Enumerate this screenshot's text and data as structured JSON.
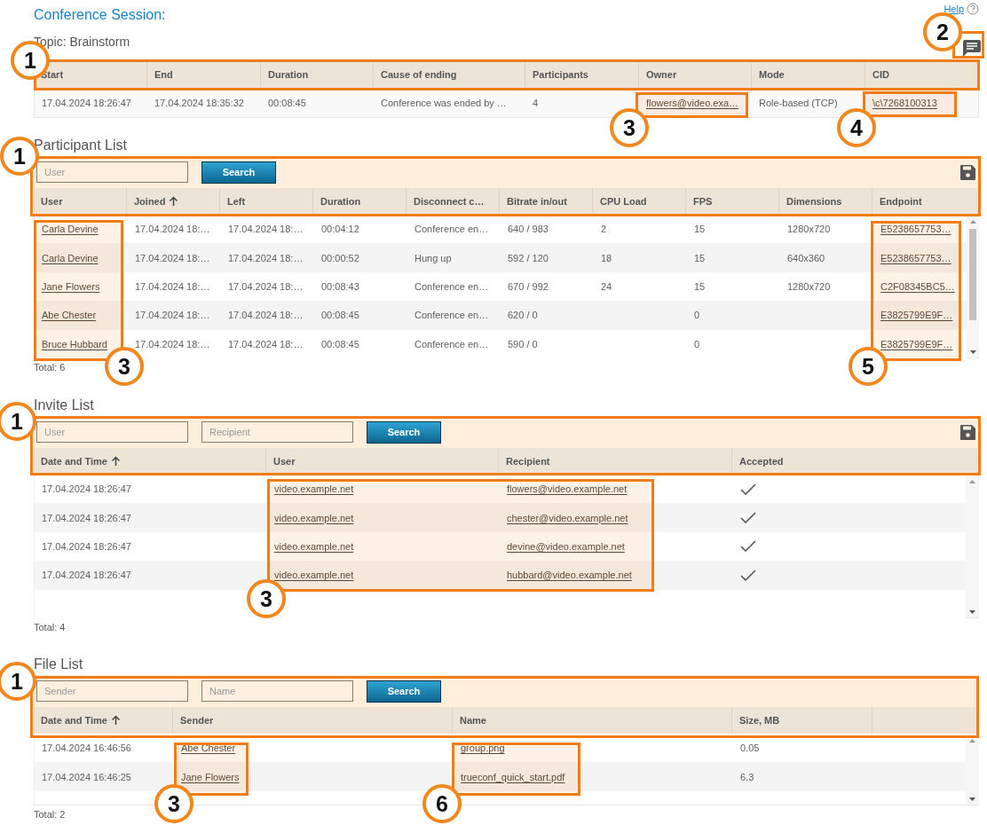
{
  "page": {
    "title": "Conference Session:",
    "help": "Help",
    "topic": "Topic: Brainstorm"
  },
  "session": {
    "columns": [
      {
        "label": "Start"
      },
      {
        "label": "End"
      },
      {
        "label": "Duration"
      },
      {
        "label": "Cause of ending"
      },
      {
        "label": "Participants"
      },
      {
        "label": "Owner"
      },
      {
        "label": "Mode"
      },
      {
        "label": "CID"
      }
    ],
    "rows": [
      [
        "17.04.2024 18:26:47",
        "17.04.2024 18:35:32",
        "00:08:45",
        "Conference was ended by …",
        "4",
        {
          "link": "flowers@video.exa…"
        },
        "Role-based (TCP)",
        {
          "link": "\\c\\7268100313"
        }
      ]
    ]
  },
  "sections": [
    {
      "title": "Participant List",
      "filters": [
        {
          "placeholder": "User"
        }
      ],
      "search_button": "Search",
      "export": true,
      "scroll_thumb": true,
      "columns": [
        {
          "label": "User",
          "sorted": false
        },
        {
          "label": "Joined",
          "sorted": true
        },
        {
          "label": "Left",
          "sorted": false
        },
        {
          "label": "Duration",
          "sorted": false
        },
        {
          "label": "Disconnect c…",
          "sorted": false
        },
        {
          "label": "Bitrate in/out",
          "sorted": false
        },
        {
          "label": "CPU Load",
          "sorted": false
        },
        {
          "label": "FPS",
          "sorted": false
        },
        {
          "label": "Dimensions",
          "sorted": false
        },
        {
          "label": "Endpoint",
          "sorted": false
        }
      ],
      "rows": [
        [
          {
            "link": "Carla Devine"
          },
          "17.04.2024 18:…",
          "17.04.2024 18:…",
          "00:04:12",
          "Conference en…",
          "640 / 983",
          "2",
          "15",
          "1280x720",
          {
            "link": "E5238657753…"
          }
        ],
        [
          {
            "link": "Carla Devine"
          },
          "17.04.2024 18:…",
          "17.04.2024 18:…",
          "00:00:52",
          "Hung up",
          "592 / 120",
          "18",
          "15",
          "640x360",
          {
            "link": "E5238657753…"
          }
        ],
        [
          {
            "link": "Jane Flowers"
          },
          "17.04.2024 18:…",
          "17.04.2024 18:…",
          "00:08:43",
          "Conference en…",
          "670 / 992",
          "24",
          "15",
          "1280x720",
          {
            "link": "C2F08345BC5…"
          }
        ],
        [
          {
            "link": "Abe Chester"
          },
          "17.04.2024 18:…",
          "17.04.2024 18:…",
          "00:08:45",
          "Conference en…",
          "620 / 0",
          null,
          "0",
          null,
          {
            "link": "E3825799E9F…"
          }
        ],
        [
          {
            "link": "Bruce Hubbard"
          },
          "17.04.2024 18:…",
          "17.04.2024 18:…",
          "00:08:45",
          "Conference en…",
          "590 / 0",
          null,
          "0",
          null,
          {
            "link": "E3825799E9F…"
          }
        ]
      ],
      "total": "Total: 6"
    },
    {
      "title": "Invite List",
      "filters": [
        {
          "placeholder": "User"
        },
        {
          "placeholder": "Recipient"
        }
      ],
      "search_button": "Search",
      "export": true,
      "scroll_thumb": false,
      "columns": [
        {
          "label": "Date and Time",
          "sorted": true
        },
        {
          "label": "User",
          "sorted": false
        },
        {
          "label": "Recipient",
          "sorted": false
        },
        {
          "label": "Accepted",
          "sorted": false
        }
      ],
      "rows": [
        [
          "17.04.2024 18:26:47",
          {
            "link": "video.example.net"
          },
          {
            "link": "flowers@video.example.net"
          },
          true
        ],
        [
          "17.04.2024 18:26:47",
          {
            "link": "video.example.net"
          },
          {
            "link": "chester@video.example.net"
          },
          true
        ],
        [
          "17.04.2024 18:26:47",
          {
            "link": "video.example.net"
          },
          {
            "link": "devine@video.example.net"
          },
          true
        ],
        [
          "17.04.2024 18:26:47",
          {
            "link": "video.example.net"
          },
          {
            "link": "hubbard@video.example.net"
          },
          true
        ]
      ],
      "total": "Total: 4"
    },
    {
      "title": "File List",
      "filters": [
        {
          "placeholder": "Sender"
        },
        {
          "placeholder": "Name"
        }
      ],
      "search_button": "Search",
      "export": false,
      "scroll_thumb": false,
      "columns": [
        {
          "label": "Date and Time",
          "sorted": true
        },
        {
          "label": "Sender",
          "sorted": false
        },
        {
          "label": "Name",
          "sorted": false
        },
        {
          "label": "Size, MB",
          "sorted": false
        }
      ],
      "rows": [
        [
          "17.04.2024 16:46:56",
          {
            "link": "Abe Chester"
          },
          {
            "link": "group.png"
          },
          "0.05"
        ],
        [
          "17.04.2024 16:46:25",
          {
            "link": "Jane Flowers"
          },
          {
            "link": "trueconf_quick_start.pdf"
          },
          "6.3"
        ]
      ],
      "total": "Total: 2"
    }
  ],
  "callouts": [
    "1",
    "2",
    "3",
    "4",
    "1",
    "3",
    "5",
    "1",
    "3",
    "1",
    "3",
    "6"
  ]
}
